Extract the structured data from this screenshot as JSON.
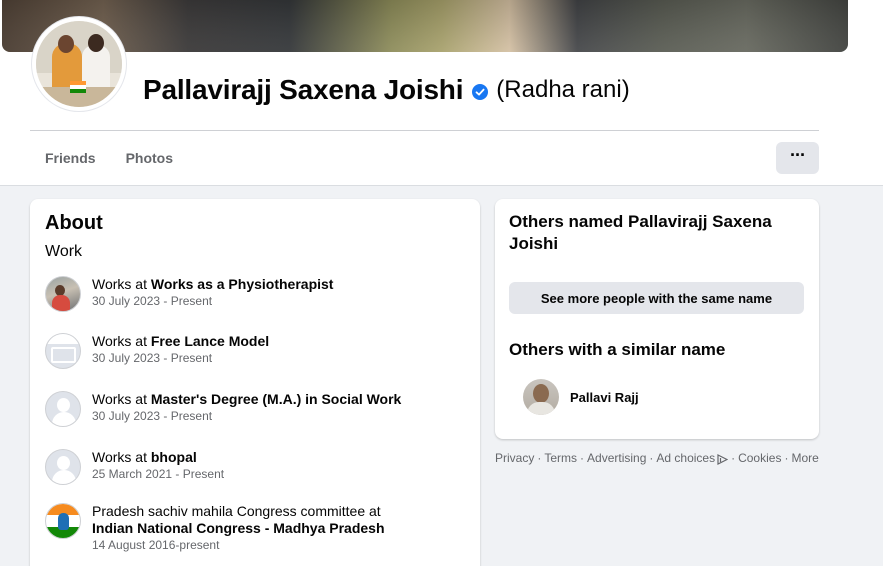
{
  "profile": {
    "name": "Pallavirajj Saxena Joishi",
    "alternate_name": "(Radha rani)",
    "verified": true
  },
  "tabs": [
    {
      "label": "Friends"
    },
    {
      "label": "Photos"
    }
  ],
  "more_button": {
    "label": "···"
  },
  "about": {
    "title": "About",
    "section_title": "Work",
    "items": [
      {
        "prefix": "Works at ",
        "place": "Works as a Physiotherapist",
        "suffix": "",
        "date": "30 July 2023 - Present",
        "icon": "photo-icon"
      },
      {
        "prefix": "Works at ",
        "place": "Free Lance Model",
        "suffix": "",
        "date": "30 July 2023 - Present",
        "icon": "page-icon"
      },
      {
        "prefix": "Works at ",
        "place": "Master's Degree (M.A.) in Social Work",
        "suffix": "",
        "date": "30 July 2023 - Present",
        "icon": "silhouette-icon"
      },
      {
        "prefix": "Works at ",
        "place": "bhopal",
        "suffix": "",
        "date": "25 March 2021 - Present",
        "icon": "silhouette-icon"
      },
      {
        "prefix": "Pradesh sachiv mahila Congress committee at ",
        "place": "Indian National Congress -  Madhya Pradesh",
        "suffix": "",
        "date": "14 August 2016-present",
        "icon": "congress-logo-icon"
      }
    ]
  },
  "others_named": {
    "title": "Others named Pallavirajj Saxena Joishi",
    "button_label": "See more people with the same name"
  },
  "similar": {
    "title": "Others with a similar name",
    "people": [
      {
        "name": "Pallavi Rajj"
      }
    ]
  },
  "footer": {
    "links": [
      "Privacy",
      "Terms",
      "Advertising",
      "Ad choices",
      "Cookies",
      "More"
    ],
    "separator": "·"
  },
  "colors": {
    "verified_badge": "#1877f2",
    "page_background": "#f0f2f5",
    "secondary_text": "#65676b"
  }
}
